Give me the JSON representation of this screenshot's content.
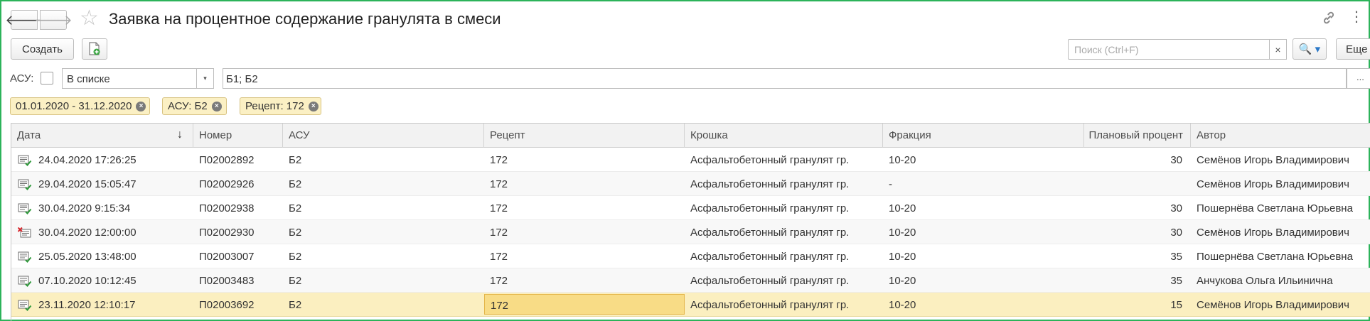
{
  "window": {
    "title": "Заявка на процентное содержание гранулята в смеси",
    "back_glyph": "🡐",
    "forward_glyph": "🡒",
    "star_glyph": "☆",
    "more_glyph": "⋮"
  },
  "toolbar": {
    "create_label": "Создать",
    "search_placeholder": "Поиск (Ctrl+F)",
    "search_clear": "×",
    "search_button": "🔍 ▾",
    "more_label": "Еще"
  },
  "filter": {
    "asu_label": "АСУ:",
    "condition_value": "В списке",
    "dropdown_glyph": "▾",
    "list_value": "Б1; Б2",
    "dots": "..."
  },
  "chips": [
    {
      "label": "01.01.2020 - 31.12.2020",
      "close": "×"
    },
    {
      "label": "АСУ: Б2",
      "close": "×"
    },
    {
      "label": "Рецепт: 172",
      "close": "×"
    }
  ],
  "table": {
    "columns": [
      "Дата",
      "Номер",
      "АСУ",
      "Рецепт",
      "Крошка",
      "Фракция",
      "Плановый процент",
      "Автор"
    ],
    "sort_glyph": "↓",
    "rows": [
      {
        "status": "posted",
        "date": "24.04.2020 17:26:25",
        "number": "П02002892",
        "asu": "Б2",
        "recipe": "172",
        "crumb": "Асфальтобетонный гранулят гр.",
        "fraction": "10-20",
        "percent": "30",
        "author": "Семёнов Игорь Владимирович"
      },
      {
        "status": "posted",
        "date": "29.04.2020 15:05:47",
        "number": "П02002926",
        "asu": "Б2",
        "recipe": "172",
        "crumb": "Асфальтобетонный гранулят гр.",
        "fraction": "-",
        "percent": "",
        "author": "Семёнов Игорь Владимирович"
      },
      {
        "status": "posted",
        "date": "30.04.2020 9:15:34",
        "number": "П02002938",
        "asu": "Б2",
        "recipe": "172",
        "crumb": "Асфальтобетонный гранулят гр.",
        "fraction": "10-20",
        "percent": "30",
        "author": "Пошернёва Светлана Юрьевна"
      },
      {
        "status": "deleted",
        "date": "30.04.2020 12:00:00",
        "number": "П02002930",
        "asu": "Б2",
        "recipe": "172",
        "crumb": "Асфальтобетонный гранулят гр.",
        "fraction": "10-20",
        "percent": "30",
        "author": "Семёнов Игорь Владимирович"
      },
      {
        "status": "posted",
        "date": "25.05.2020 13:48:00",
        "number": "П02003007",
        "asu": "Б2",
        "recipe": "172",
        "crumb": "Асфальтобетонный гранулят гр.",
        "fraction": "10-20",
        "percent": "35",
        "author": "Пошернёва Светлана Юрьевна"
      },
      {
        "status": "posted",
        "date": "07.10.2020 10:12:45",
        "number": "П02003483",
        "asu": "Б2",
        "recipe": "172",
        "crumb": "Асфальтобетонный гранулят гр.",
        "fraction": "10-20",
        "percent": "35",
        "author": "Анчукова Ольга Ильинична"
      },
      {
        "status": "posted",
        "date": "23.11.2020 12:10:17",
        "number": "П02003692",
        "asu": "Б2",
        "recipe": "172",
        "crumb": "Асфальтобетонный гранулят гр.",
        "fraction": "10-20",
        "percent": "15",
        "author": "Семёнов Игорь Владимирович"
      }
    ]
  },
  "colors": {
    "frame_border": "#2cb35a",
    "chip_bg": "#fbf0c4",
    "selected_row": "#fbefc0",
    "focused_cell": "#f8dc86",
    "posted_mark": "#2e9a3a",
    "deleted_mark": "#d6262c"
  }
}
